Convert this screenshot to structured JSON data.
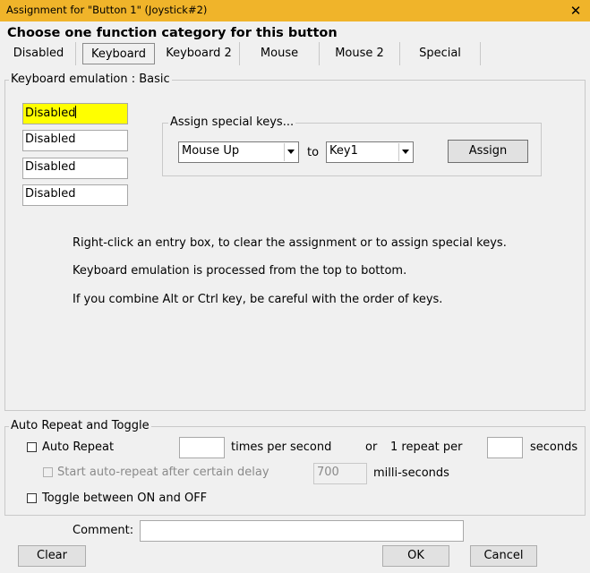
{
  "window": {
    "title": "Assignment for \"Button 1\" (Joystick#2)",
    "close_glyph": "✕"
  },
  "header": "Choose one function category for this button",
  "tabs": [
    {
      "label": "Disabled"
    },
    {
      "label": "Keyboard"
    },
    {
      "label": "Keyboard 2"
    },
    {
      "label": "Mouse"
    },
    {
      "label": "Mouse 2"
    },
    {
      "label": "Special"
    }
  ],
  "keyboard_group": {
    "legend": "Keyboard emulation : Basic",
    "entries": [
      "Disabled",
      "Disabled",
      "Disabled",
      "Disabled"
    ],
    "special_keys": {
      "legend": "Assign special keys...",
      "from_value": "Mouse Up",
      "to_label": "to",
      "to_value": "Key1",
      "assign_label": "Assign"
    },
    "notes": [
      "Right-click an entry box, to clear the assignment or to assign special keys.",
      "Keyboard emulation is processed from the top to bottom.",
      "If you combine Alt or Ctrl key, be careful with the order of keys."
    ]
  },
  "repeat_group": {
    "legend": "Auto Repeat and Toggle",
    "auto_repeat_label": "Auto Repeat",
    "times_value": "",
    "times_label": "times per second",
    "or_label": "or",
    "repeat_per_label": "1 repeat per",
    "seconds_value": "",
    "seconds_label": "seconds",
    "delay_label": "Start auto-repeat after certain delay",
    "delay_value": "700",
    "ms_label": "milli-seconds",
    "toggle_label": "Toggle between ON and OFF"
  },
  "comment": {
    "label": "Comment:",
    "value": ""
  },
  "buttons": {
    "clear": "Clear",
    "ok": "OK",
    "cancel": "Cancel"
  },
  "colors": {
    "titlebar": "#f0b42a",
    "highlight": "#ffff00"
  }
}
